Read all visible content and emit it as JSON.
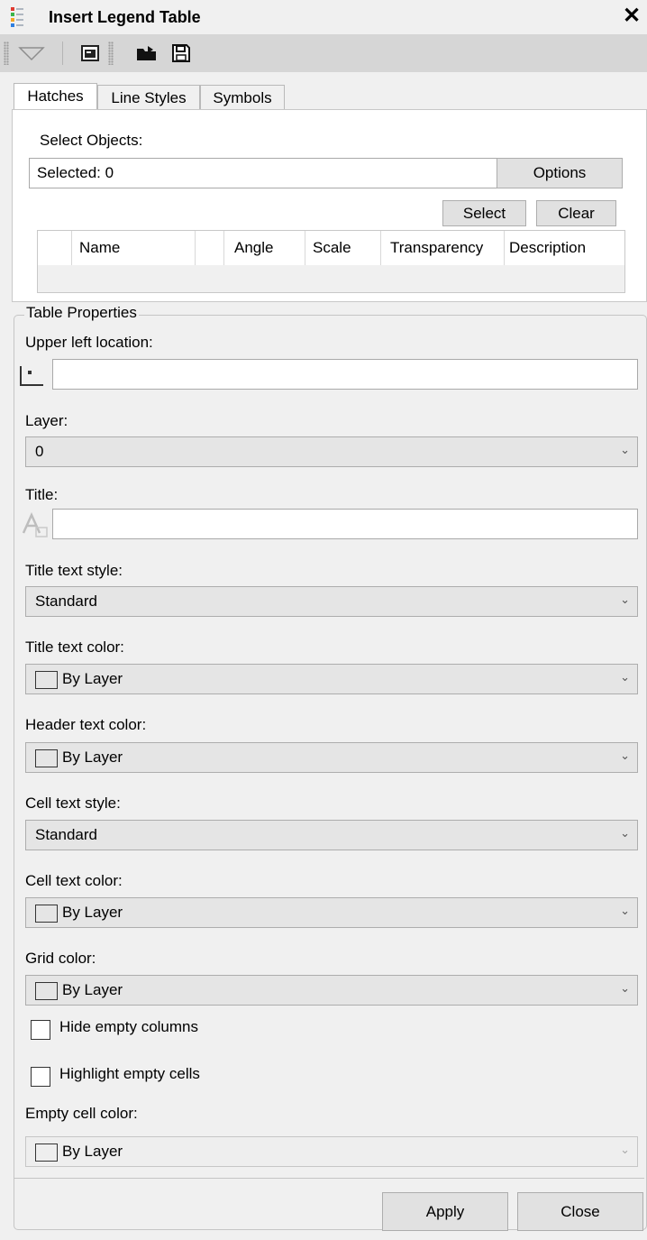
{
  "window": {
    "title": "Insert Legend Table",
    "close_glyph": "✕"
  },
  "toolbar": {
    "icons": [
      "dropdown-arrow-icon",
      "command-window-icon",
      "open-folder-icon",
      "save-icon"
    ]
  },
  "tabs": [
    {
      "label": "Hatches",
      "active": true
    },
    {
      "label": "Line Styles",
      "active": false
    },
    {
      "label": "Symbols",
      "active": false
    }
  ],
  "select_objects": {
    "label": "Select Objects:",
    "selected_value": "Selected: 0",
    "options_button": "Options",
    "select_button": "Select",
    "clear_button": "Clear"
  },
  "grid": {
    "columns": [
      "",
      "Name",
      "",
      "Angle",
      "Scale",
      "Transparency",
      "Description"
    ]
  },
  "table_properties": {
    "group_label": "Table Properties",
    "upper_left_location": {
      "label": "Upper left location:",
      "value": ""
    },
    "layer": {
      "label": "Layer:",
      "value": "0"
    },
    "title": {
      "label": "Title:",
      "value": ""
    },
    "title_text_style": {
      "label": "Title text style:",
      "value": "Standard"
    },
    "title_text_color": {
      "label": "Title text color:",
      "value": "By Layer"
    },
    "header_text_color": {
      "label": "Header text color:",
      "value": "By Layer"
    },
    "cell_text_style": {
      "label": "Cell text style:",
      "value": "Standard"
    },
    "cell_text_color": {
      "label": "Cell text color:",
      "value": "By Layer"
    },
    "grid_color": {
      "label": "Grid color:",
      "value": "By Layer"
    },
    "hide_empty_columns": {
      "label": "Hide empty columns",
      "checked": false
    },
    "highlight_empty_cells": {
      "label": "Highlight empty cells",
      "checked": false
    },
    "empty_cell_color": {
      "label": "Empty cell color:",
      "value": "By Layer"
    }
  },
  "footer": {
    "apply_button": "Apply",
    "close_button": "Close"
  },
  "colors": {
    "window_bg": "#f0f0f0",
    "toolbar_bg": "#d6d6d6",
    "combo_bg": "#e5e5e5",
    "button_bg": "#e1e1e1",
    "border": "#adadad"
  }
}
